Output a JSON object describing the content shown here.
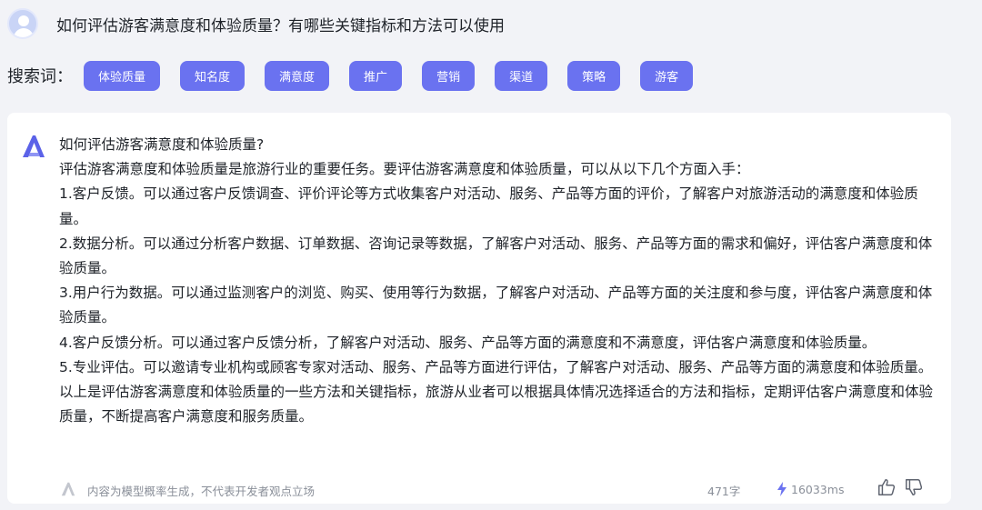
{
  "question": {
    "text": "如何评估游客满意度和体验质量？有哪些关键指标和方法可以使用"
  },
  "keywords": {
    "label": "搜索词：",
    "items": [
      "体验质量",
      "知名度",
      "满意度",
      "推广",
      "营销",
      "渠道",
      "策略",
      "游客"
    ]
  },
  "answer": {
    "lines": [
      "如何评估游客满意度和体验质量?",
      "评估游客满意度和体验质量是旅游行业的重要任务。要评估游客满意度和体验质量，可以从以下几个方面入手：",
      "1.客户反馈。可以通过客户反馈调查、评价评论等方式收集客户对活动、服务、产品等方面的评价，了解客户对旅游活动的满意度和体验质量。",
      "2.数据分析。可以通过分析客户数据、订单数据、咨询记录等数据，了解客户对活动、服务、产品等方面的需求和偏好，评估客户满意度和体验质量。",
      "3.用户行为数据。可以通过监测客户的浏览、购买、使用等行为数据，了解客户对活动、产品等方面的关注度和参与度，评估客户满意度和体验质量。",
      "4.客户反馈分析。可以通过客户反馈分析，了解客户对活动、服务、产品等方面的满意度和不满意度，评估客户满意度和体验质量。",
      "5.专业评估。可以邀请专业机构或顾客专家对活动、服务、产品等方面进行评估，了解客户对活动、服务、产品等方面的满意度和体验质量。",
      "以上是评估游客满意度和体验质量的一些方法和关键指标，旅游从业者可以根据具体情况选择适合的方法和指标，定期评估客户满意度和体验质量，不断提高客户满意度和服务质量。"
    ]
  },
  "footer": {
    "disclaimer": "内容为模型概率生成，不代表开发者观点立场",
    "char_count": "471字",
    "duration": "16033ms"
  },
  "colors": {
    "accent": "#6a72f0",
    "logo": "#5b62e8",
    "background": "#f2f3f7",
    "card": "#ffffff"
  },
  "icons": {
    "avatar": "user-avatar-icon",
    "logo": "brand-a-logo-icon",
    "bolt": "lightning-bolt-icon",
    "thumb_up": "thumbs-up-icon",
    "thumb_down": "thumbs-down-icon"
  }
}
